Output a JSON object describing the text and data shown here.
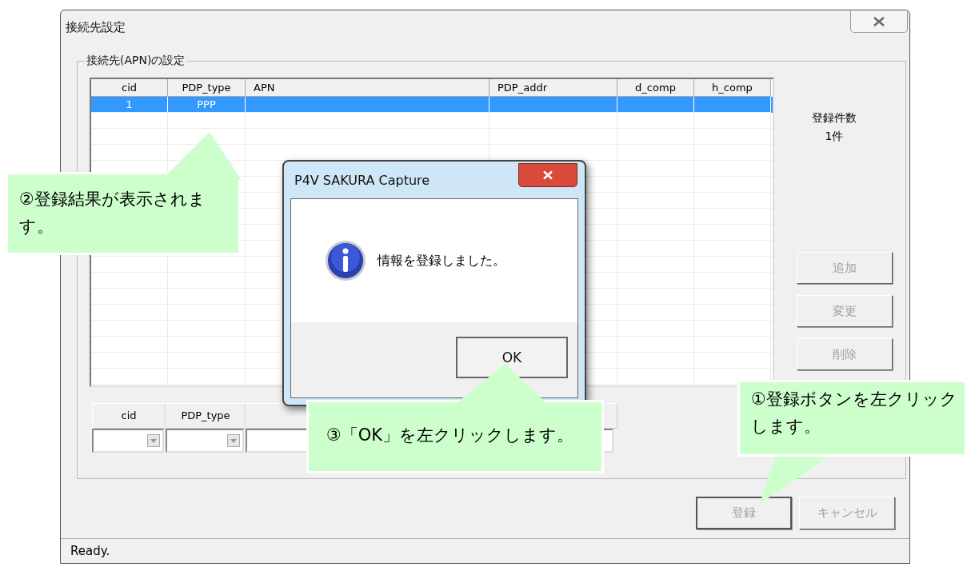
{
  "window": {
    "title": "接続先設定"
  },
  "group_title": "接続先(APN)の設定",
  "table": {
    "columns": [
      "cid",
      "PDP_type",
      "APN",
      "PDP_addr",
      "d_comp",
      "h_comp"
    ],
    "rows": [
      {
        "cells": [
          "1",
          "PPP",
          "",
          "",
          "",
          ""
        ],
        "selected": true
      }
    ]
  },
  "count": {
    "label": "登録件数",
    "value": "1件"
  },
  "side_buttons": [
    {
      "label": "追加",
      "disabled": true
    },
    {
      "label": "変更",
      "disabled": true
    },
    {
      "label": "削除",
      "disabled": true
    }
  ],
  "edit_row": {
    "columns": [
      "cid",
      "PDP_type"
    ]
  },
  "footer_buttons": [
    {
      "label": "登録",
      "disabled": true
    },
    {
      "label": "キャンセル",
      "disabled": true
    }
  ],
  "status_bar": "Ready.",
  "message_box": {
    "title": "P4V SAKURA Capture",
    "text": "情報を登録しました。",
    "button": "OK"
  },
  "callouts": [
    {
      "text": "②登録結果が表示されます。"
    },
    {
      "text": "③「OK」を左クリックします。"
    },
    {
      "text": "①登録ボタンを左クリックします。"
    }
  ]
}
